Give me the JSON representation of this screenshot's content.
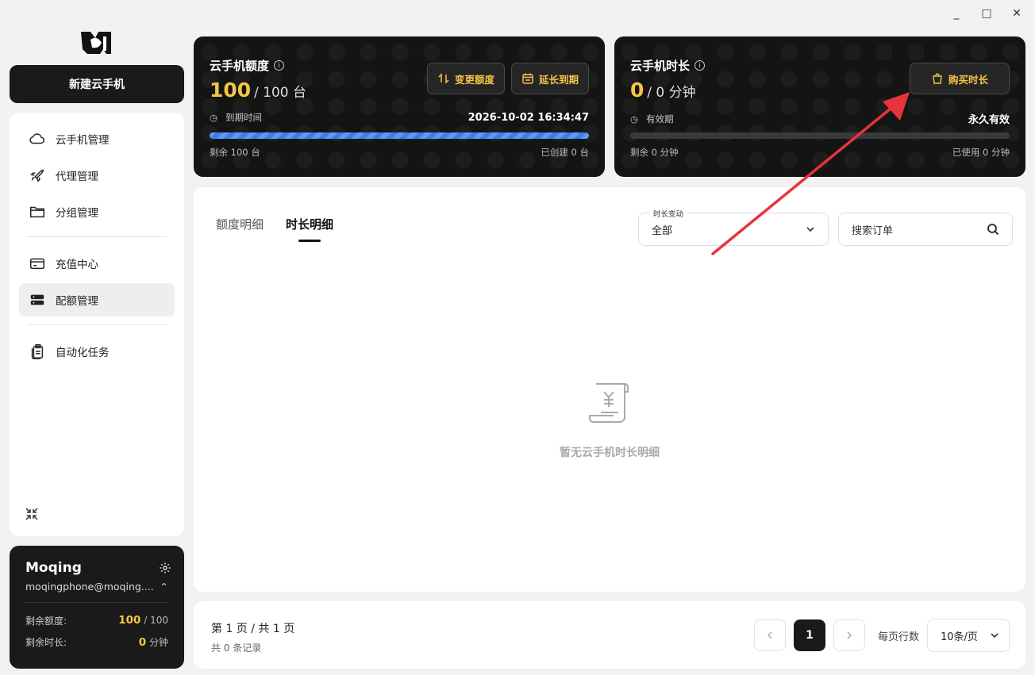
{
  "window": {
    "minimize": "_",
    "maximize": "□",
    "close": "✕"
  },
  "sidebar": {
    "new_button": "新建云手机",
    "items": [
      {
        "label": "云手机管理",
        "icon": "cloud-icon"
      },
      {
        "label": "代理管理",
        "icon": "rocket-icon"
      },
      {
        "label": "分组管理",
        "icon": "folder-icon"
      },
      {
        "label": "充值中心",
        "icon": "card-icon"
      },
      {
        "label": "配额管理",
        "icon": "server-icon",
        "active": true
      },
      {
        "label": "自动化任务",
        "icon": "clipboard-icon"
      }
    ]
  },
  "user": {
    "name": "Moqing",
    "email": "moqingphone@moqing....",
    "quota_label": "剩余额度:",
    "quota_value": "100",
    "quota_total": "/ 100",
    "time_label": "剩余时长:",
    "time_value": "0",
    "time_unit": "分钟"
  },
  "quota_card": {
    "title": "云手机额度",
    "value": "100",
    "total": "/ 100 台",
    "change_btn": "变更额度",
    "extend_btn": "延长到期",
    "expire_label": "到期时间",
    "expire_value": "2026-10-02 16:34:47",
    "progress": 1.0,
    "remain": "剩余 100 台",
    "created": "已创建 0 台"
  },
  "time_card": {
    "title": "云手机时长",
    "value": "0",
    "total": "/ 0 分钟",
    "buy_btn": "购买时长",
    "valid_label": "有效期",
    "valid_value": "永久有效",
    "progress": 0,
    "remain": "剩余 0 分钟",
    "used": "已使用 0 分钟"
  },
  "main": {
    "tabs": [
      {
        "label": "额度明细",
        "active": false
      },
      {
        "label": "时长明细",
        "active": true
      }
    ],
    "filter_label": "时长变动",
    "filter_value": "全部",
    "search_placeholder": "搜索订单",
    "empty_text": "暂无云手机时长明细"
  },
  "footer": {
    "page_info": "第 1 页 / 共 1 页",
    "record_info": "共 0 条记录",
    "current_page": "1",
    "per_page_label": "每页行数",
    "per_page_value": "10条/页"
  },
  "colors": {
    "accent": "#f5c547",
    "progress": "#4a8bf0",
    "annotation": "#e8333a"
  }
}
